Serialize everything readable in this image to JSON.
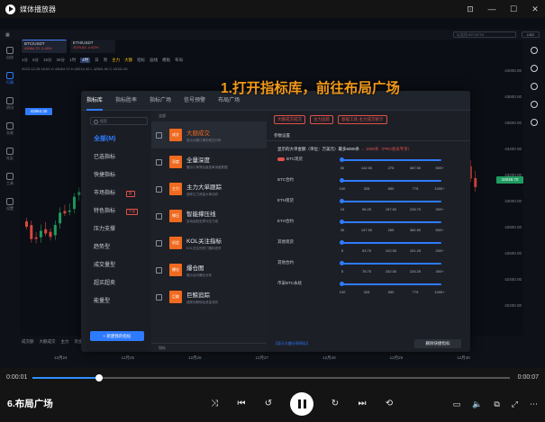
{
  "player": {
    "title": "媒体播放器",
    "clip_title": "6.布局广场",
    "time_current": "0:00:01",
    "time_total": "0:00:07",
    "progress": 0.14
  },
  "caption": "1.打开指标库，前往布局广场",
  "app": {
    "search_placeholder": "以太坊 BTC/ETH",
    "currency": "USD",
    "tabs": [
      {
        "symbol": "BTC/USDT",
        "sub": "43064.70 -1.45%"
      },
      {
        "symbol": "ETH/USDT",
        "sub": "2079.83 -4.62%"
      }
    ],
    "toolbar": [
      "1分",
      "5分",
      "15分",
      "30分",
      "1时",
      "4时",
      "日",
      "周",
      "主力",
      "大额",
      "指标",
      "画线",
      "模板",
      "布局"
    ],
    "toolbar_selected": "4时",
    "chart_info": "2023-12-28 16:00  O 43064.70  H 43210.00  L 42981.00  C 43111.00",
    "left_rail": [
      {
        "label": "自选",
        "icon": "star-icon"
      },
      {
        "label": "行情",
        "icon": "chart-icon"
      },
      {
        "label": "资讯",
        "icon": "news-icon"
      },
      {
        "label": "交易",
        "icon": "trade-icon"
      },
      {
        "label": "社区",
        "icon": "community-icon"
      },
      {
        "label": "工具",
        "icon": "tool-icon"
      },
      {
        "label": "设置",
        "icon": "gear-icon"
      }
    ],
    "price_axis": [
      "44000.00",
      "43800.00",
      "43600.00",
      "43400.00",
      "43200.00",
      "43000.00",
      "42800.00",
      "42600.00",
      "42400.00",
      "42200.00"
    ],
    "price_tag_current": "43048.70",
    "price_tag_mark": "42864.30",
    "bottom_tabs": [
      "成交额",
      "大额成交",
      "主力",
      "资金",
      "MA",
      "持仓500位的MSOUPDF",
      "MACD",
      "Volume",
      "MA"
    ],
    "bottom_dates": [
      "12月24",
      "12月25",
      "12月26",
      "12月27",
      "12月28",
      "12月29",
      "12月30"
    ]
  },
  "modal": {
    "tabs": [
      "指标库",
      "指标胜率",
      "指标广场",
      "信号预警",
      "布局广场"
    ],
    "search_placeholder": "搜索",
    "categories": [
      {
        "label": "全部(M)",
        "badge": ""
      },
      {
        "label": "已选指标",
        "badge": ""
      },
      {
        "label": "快捷指标",
        "badge": ""
      },
      {
        "label": "市场指标",
        "badge": "新"
      },
      {
        "label": "特色指标",
        "badge": "只读"
      },
      {
        "label": "压力支撑",
        "badge": ""
      },
      {
        "label": "趋势型",
        "badge": ""
      },
      {
        "label": "成交量型",
        "badge": ""
      },
      {
        "label": "超买超卖",
        "badge": ""
      },
      {
        "label": "能量型",
        "badge": ""
      }
    ],
    "add_button": "+ 新建我的指标",
    "list_header": "全部",
    "list_footer": "指标",
    "indicators": [
      {
        "badge": "成交",
        "name": "大额成交",
        "desc": "显示大额订单的成交分布"
      },
      {
        "badge": "深度",
        "name": "全量深度",
        "desc": "展示订单簿全量挂单深度数据"
      },
      {
        "badge": "主力",
        "name": "主力大单跟踪",
        "desc": "追踪主力资金大单动向"
      },
      {
        "badge": "撑压",
        "name": "智能撑压线",
        "desc": "自动绘制支撑与压力线"
      },
      {
        "badge": "机会",
        "name": "KOL关注指标",
        "desc": "KOL关注的热门指标信号"
      },
      {
        "badge": "爆仓",
        "name": "爆仓图",
        "desc": "展示合约爆仓分布"
      },
      {
        "badge": "巨鲸",
        "name": "巨鲸追踪",
        "desc": "追踪巨鲸地址资金流向"
      }
    ],
    "settings": {
      "chips": [
        "大额成交成交",
        "主力追踪",
        "基础工具-主力成交统计"
      ],
      "title": "参数设置",
      "caption_prefix": "显示的大单金额（单位：万美元）最多5000条",
      "caption_link": "→ 1000条（PRO会员专享）",
      "rows": [
        {
          "label": "BTC现货",
          "toggle": true,
          "ticks": [
            "50",
            "142.50",
            "275",
            "387.50",
            "500+"
          ]
        },
        {
          "label": "BTC合约",
          "toggle": false,
          "ticks": [
            "100",
            "325",
            "550",
            "775",
            "1000+"
          ]
        },
        {
          "label": "ETH现货",
          "toggle": false,
          "ticks": [
            "15",
            "96.25",
            "157.50",
            "228.75",
            "300+"
          ]
        },
        {
          "label": "ETH合约",
          "toggle": false,
          "ticks": [
            "30",
            "147.50",
            "265",
            "382.50",
            "500+"
          ]
        },
        {
          "label": "其他现货",
          "toggle": false,
          "ticks": [
            "5",
            "53.75",
            "102.50",
            "151.25",
            "200+"
          ]
        },
        {
          "label": "其他合约",
          "toggle": false,
          "ticks": [
            "5",
            "78.75",
            "152.50",
            "226.25",
            "300+"
          ]
        },
        {
          "label": "币安BTC永续",
          "toggle": false,
          "ticks": [
            "100",
            "325",
            "550",
            "775",
            "1000+"
          ]
        }
      ],
      "footer_link": "【显示大额分享网址】",
      "save_button": "删除快捷指标"
    }
  }
}
